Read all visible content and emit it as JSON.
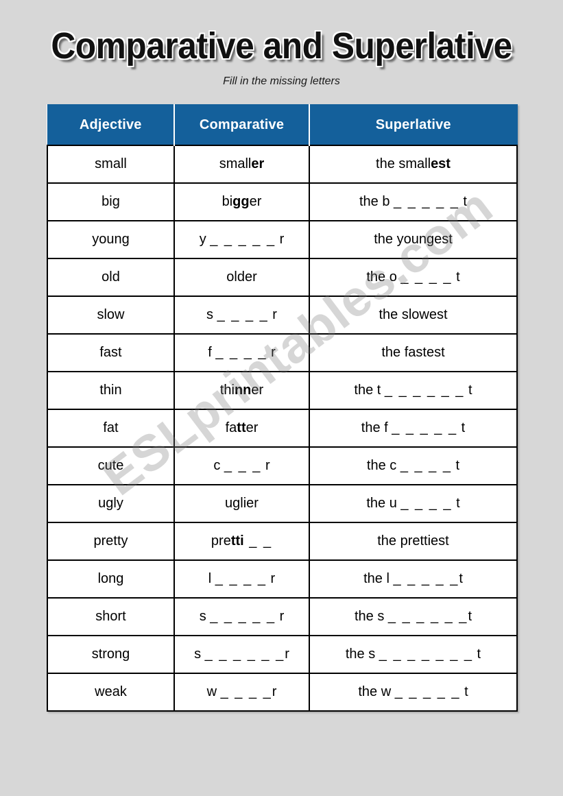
{
  "header": {
    "title": "Comparative and Superlative",
    "subtitle": "Fill in the missing letters"
  },
  "watermark": {
    "text": "ESLprintables.com"
  },
  "colors": {
    "header_blue": "#14609b",
    "page_background": "#d7d7d7",
    "cell_background": "#ffffff",
    "border": "#000000",
    "text": "#000000",
    "watermark": "#787878"
  },
  "table": {
    "columns": [
      {
        "label": "Adjective"
      },
      {
        "label": "Comparative"
      },
      {
        "label": "Superlative"
      }
    ],
    "rows": [
      {
        "adjective": "small",
        "comparative_stem": "small",
        "comparative_bold": "er",
        "comparative_blank": "",
        "comparative_tail": "",
        "superlative_stem": "the small",
        "superlative_bold": "est",
        "superlative_blank": "",
        "superlative_tail": ""
      },
      {
        "adjective": "big",
        "comparative_stem": "bi",
        "comparative_bold": "gg",
        "comparative_blank": "",
        "comparative_tail": "er",
        "superlative_stem": "the b ",
        "superlative_bold": "",
        "superlative_blank": "_ _ _ _ _",
        "superlative_tail": " t"
      },
      {
        "adjective": "young",
        "comparative_stem": "y ",
        "comparative_bold": "",
        "comparative_blank": "_ _ _ _ _",
        "comparative_tail": " r",
        "superlative_stem": "the youngest",
        "superlative_bold": "",
        "superlative_blank": "",
        "superlative_tail": ""
      },
      {
        "adjective": "old",
        "comparative_stem": "older",
        "comparative_bold": "",
        "comparative_blank": "",
        "comparative_tail": "",
        "superlative_stem": "the o ",
        "superlative_bold": "",
        "superlative_blank": "_ _ _ _",
        "superlative_tail": " t"
      },
      {
        "adjective": "slow",
        "comparative_stem": "s ",
        "comparative_bold": "",
        "comparative_blank": "_ _ _ _",
        "comparative_tail": " r",
        "superlative_stem": "the slowest",
        "superlative_bold": "",
        "superlative_blank": "",
        "superlative_tail": ""
      },
      {
        "adjective": "fast",
        "comparative_stem": "f ",
        "comparative_bold": "",
        "comparative_blank": "_ _ _ _",
        "comparative_tail": " r",
        "superlative_stem": "the fastest",
        "superlative_bold": "",
        "superlative_blank": "",
        "superlative_tail": ""
      },
      {
        "adjective": "thin",
        "comparative_stem": "thi",
        "comparative_bold": "nn",
        "comparative_blank": "",
        "comparative_tail": "er",
        "superlative_stem": "the t ",
        "superlative_bold": "",
        "superlative_blank": "_ _ _ _ _ _",
        "superlative_tail": " t"
      },
      {
        "adjective": "fat",
        "comparative_stem": "fa",
        "comparative_bold": "tt",
        "comparative_blank": "",
        "comparative_tail": "er",
        "superlative_stem": "the f ",
        "superlative_bold": "",
        "superlative_blank": "_ _ _ _ _",
        "superlative_tail": " t"
      },
      {
        "adjective": "cute",
        "comparative_stem": "c ",
        "comparative_bold": "",
        "comparative_blank": "_ _ _",
        "comparative_tail": " r",
        "superlative_stem": "the c ",
        "superlative_bold": "",
        "superlative_blank": "_ _ _ _",
        "superlative_tail": " t"
      },
      {
        "adjective": "ugly",
        "comparative_stem": "uglier",
        "comparative_bold": "",
        "comparative_blank": "",
        "comparative_tail": "",
        "superlative_stem": "the u ",
        "superlative_bold": "",
        "superlative_blank": "_ _ _ _",
        "superlative_tail": " t"
      },
      {
        "adjective": "pretty",
        "comparative_stem": "pre",
        "comparative_bold": "tti",
        "comparative_blank": " _ _",
        "comparative_tail": "",
        "superlative_stem": "the prettiest",
        "superlative_bold": "",
        "superlative_blank": "",
        "superlative_tail": ""
      },
      {
        "adjective": "long",
        "comparative_stem": "l ",
        "comparative_bold": "",
        "comparative_blank": "_ _ _ _",
        "comparative_tail": " r",
        "superlative_stem": "the l ",
        "superlative_bold": "",
        "superlative_blank": "_ _ _ _ _",
        "superlative_tail": "t"
      },
      {
        "adjective": "short",
        "comparative_stem": "s ",
        "comparative_bold": "",
        "comparative_blank": "_ _ _ _ _",
        "comparative_tail": " r",
        "superlative_stem": "the s ",
        "superlative_bold": "",
        "superlative_blank": "_ _ _ _ _ _",
        "superlative_tail": "t"
      },
      {
        "adjective": "strong",
        "comparative_stem": "s ",
        "comparative_bold": "",
        "comparative_blank": "_ _ _ _ _ _",
        "comparative_tail": "r",
        "superlative_stem": "the s ",
        "superlative_bold": "",
        "superlative_blank": "_ _ _ _ _ _ _",
        "superlative_tail": " t"
      },
      {
        "adjective": "weak",
        "comparative_stem": "w ",
        "comparative_bold": "",
        "comparative_blank": "_ _ _ _",
        "comparative_tail": "r",
        "superlative_stem": "the w ",
        "superlative_bold": "",
        "superlative_blank": "_ _ _ _ _",
        "superlative_tail": " t"
      }
    ]
  }
}
